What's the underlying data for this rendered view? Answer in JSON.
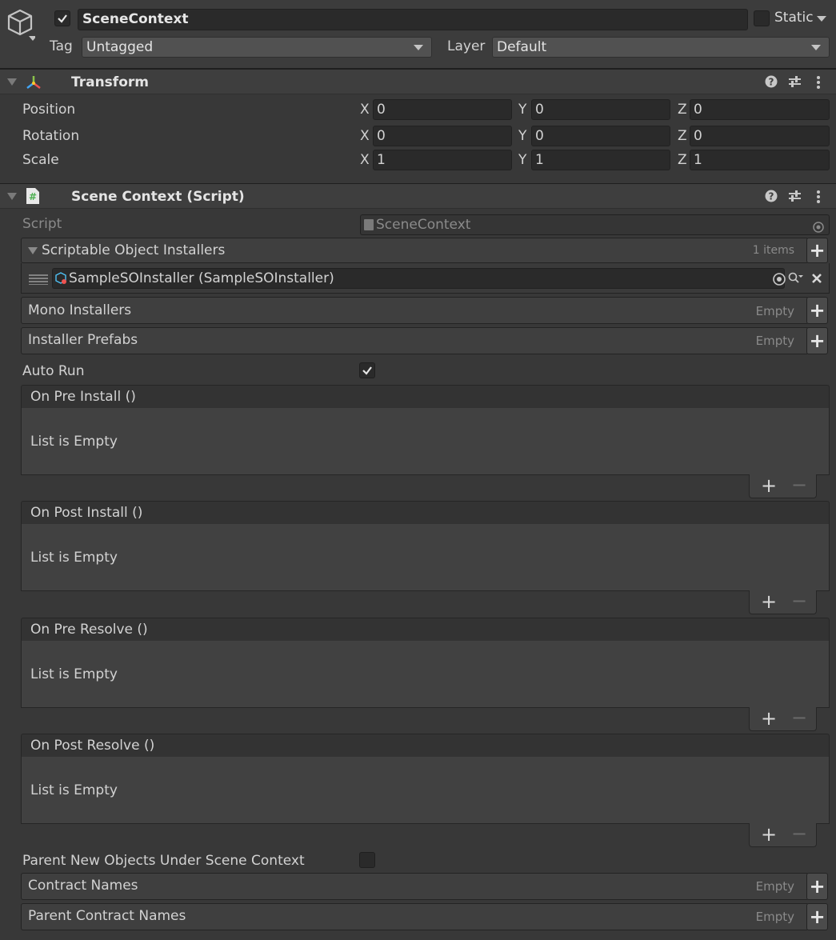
{
  "gameobject": {
    "name": "SceneContext",
    "active": true,
    "static_label": "Static",
    "tag_label": "Tag",
    "tag_value": "Untagged",
    "layer_label": "Layer",
    "layer_value": "Default"
  },
  "transform": {
    "title": "Transform",
    "rows": [
      {
        "label": "Position",
        "x": "0",
        "y": "0",
        "z": "0"
      },
      {
        "label": "Rotation",
        "x": "0",
        "y": "0",
        "z": "0"
      },
      {
        "label": "Scale",
        "x": "1",
        "y": "1",
        "z": "1"
      }
    ],
    "axis": {
      "x": "X",
      "y": "Y",
      "z": "Z"
    }
  },
  "scene_context": {
    "title": "Scene Context (Script)",
    "script_label": "Script",
    "script_value": "SceneContext",
    "so_installers": {
      "label": "Scriptable Object Installers",
      "count": "1 items",
      "items": [
        "SampleSOInstaller (SampleSOInstaller)"
      ]
    },
    "mono_installers": {
      "label": "Mono Installers",
      "status": "Empty"
    },
    "installer_prefabs": {
      "label": "Installer Prefabs",
      "status": "Empty"
    },
    "auto_run": {
      "label": "Auto Run",
      "checked": true
    },
    "events": [
      {
        "label": "On Pre Install ()",
        "empty": "List is Empty"
      },
      {
        "label": "On Post Install ()",
        "empty": "List is Empty"
      },
      {
        "label": "On Pre Resolve ()",
        "empty": "List is Empty"
      },
      {
        "label": "On Post Resolve ()",
        "empty": "List is Empty"
      }
    ],
    "parent_new_objects": {
      "label": "Parent New Objects Under Scene Context",
      "checked": false
    },
    "contract_names": {
      "label": "Contract Names",
      "status": "Empty"
    },
    "parent_contract_names": {
      "label": "Parent Contract Names",
      "status": "Empty"
    }
  },
  "icons": {
    "gameobject": "cube-icon",
    "transform": "transform-axes-icon",
    "script": "csharp-script-icon",
    "help": "help-icon",
    "presets": "presets-icon",
    "more": "kebab-menu-icon",
    "object_picker": "object-picker-icon",
    "remove": "close-icon",
    "drag": "drag-handle-icon"
  },
  "colors": {
    "background": "#383838",
    "field": "#2a2a2a",
    "header": "#3e3e3e",
    "text": "#d2d2d2",
    "accent_script_icon": "#4caf50"
  }
}
